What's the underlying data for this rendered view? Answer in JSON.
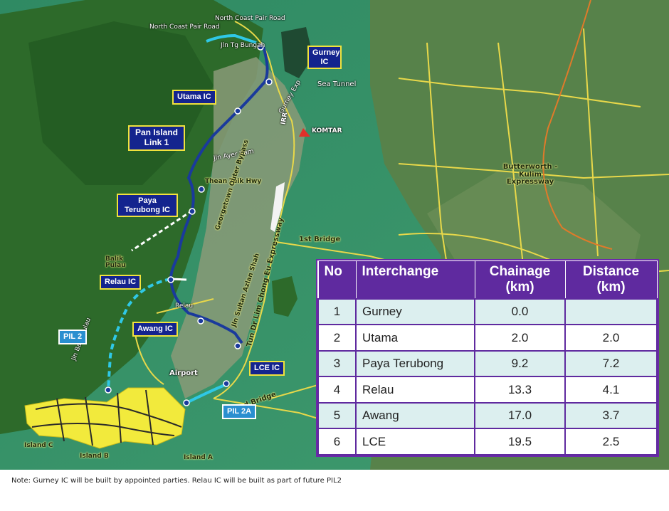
{
  "labels": {
    "north_coast_pair_road_1": "North Coast Pair Road",
    "north_coast_pair_road_2": "North Coast Pair Road",
    "jln_tg_bungah": "Jln Tg Bungah",
    "sea_tunnel": "Sea Tunnel",
    "gurney_exp": "Gurney Exp",
    "komtar": "KOMTAR",
    "irr": "IRR",
    "jln_ayer_itam": "Jln Ayer Itam",
    "thean_teik_hwy": "Thean Teik Hwy",
    "georgetown_outer_bypass": "Georgetown Outer Bypass",
    "first_bridge": "1st Bridge",
    "second_bridge": "2nd Bridge",
    "balik_pulau": "Balik Pulau",
    "jln_balik_pulau": "Jln Balik Pulau",
    "relau": "Relau",
    "airport": "Airport",
    "jln_sultan_azlan_shah": "Jln Sultan Azlan Shah",
    "tun_dr_lim_chong_eu_expressway": "Tun Dr Lim Chong Eu Expressway",
    "butterworth_kulim_expressway": "Butterworth - Kulim Expressway",
    "island_a": "Island A",
    "island_b": "Island B",
    "island_c": "Island C"
  },
  "interchange_boxes": {
    "gurney_ic": "Gurney IC",
    "utama_ic": "Utama IC",
    "pan_island_link": "Pan Island Link 1",
    "paya_terubong_ic": "Paya Terubong IC",
    "relau_ic": "Relau IC",
    "awang_ic": "Awang IC",
    "lce_ic": "LCE IC",
    "pil2": "PIL 2",
    "pil2a": "PIL 2A"
  },
  "table": {
    "headers": {
      "no": "No",
      "interchange": "Interchange",
      "chainage": "Chainage (km)",
      "distance": "Distance (km)"
    },
    "rows": [
      {
        "no": "1",
        "interchange": "Gurney",
        "chainage": "0.0",
        "distance": ""
      },
      {
        "no": "2",
        "interchange": "Utama",
        "chainage": "2.0",
        "distance": "2.0"
      },
      {
        "no": "3",
        "interchange": "Paya Terubong",
        "chainage": "9.2",
        "distance": "7.2"
      },
      {
        "no": "4",
        "interchange": "Relau",
        "chainage": "13.3",
        "distance": "4.1"
      },
      {
        "no": "5",
        "interchange": "Awang",
        "chainage": "17.0",
        "distance": "3.7"
      },
      {
        "no": "6",
        "interchange": "LCE",
        "chainage": "19.5",
        "distance": "2.5"
      }
    ]
  },
  "note": "Note: Gurney IC will be built by appointed parties. Relau IC will be built as part of future PIL2",
  "colors": {
    "pil1_route": "#1a3a9c",
    "pil2_route": "#2fc8e6",
    "roads": "#e8d84a",
    "table_header": "#5f2a9f",
    "reclaimed_islands": "#f2ea3c"
  }
}
